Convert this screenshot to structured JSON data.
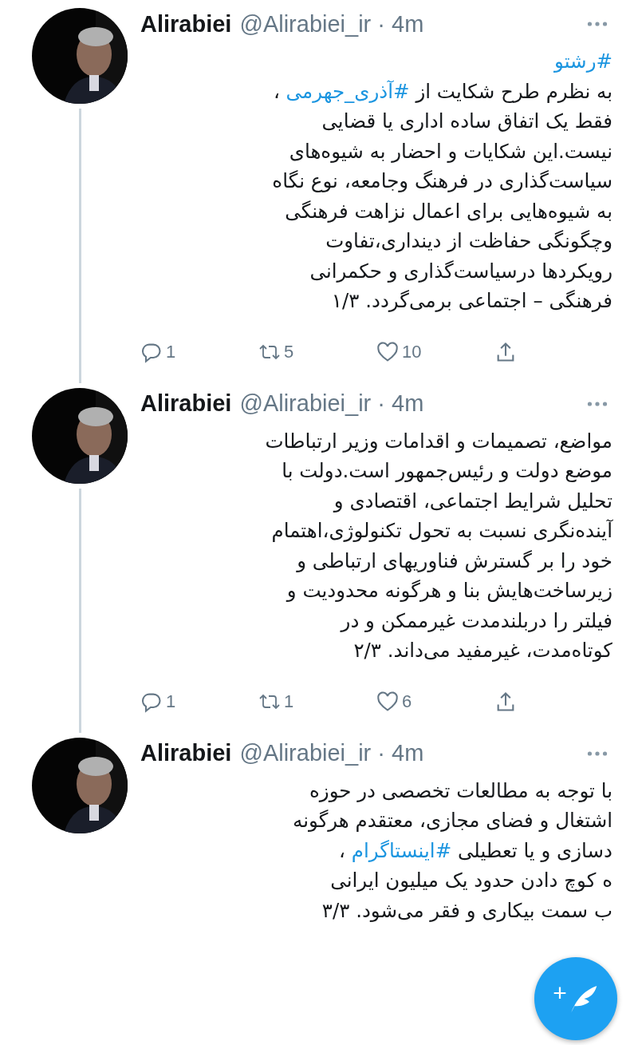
{
  "tweets": [
    {
      "name": "Alirabiei",
      "handle_time": "@Alirabiei_ir · 4m",
      "avatar": {
        "kind": "picture"
      },
      "lines": [
        [
          {
            "text": "#رشتو",
            "kind": "hashtag"
          }
        ],
        [
          {
            "text": "به نظرم طرح شکایت از ",
            "kind": "text"
          },
          {
            "text": "#آذری_جهرمی",
            "kind": "hashtag"
          },
          {
            "text": " ،",
            "kind": "text"
          }
        ],
        [
          {
            "text": "فقط یک اتفاق ساده اداری یا قضایی",
            "kind": "text"
          }
        ],
        [
          {
            "text": "نیست.این شکایات و احضار به شیوه‌های",
            "kind": "text"
          }
        ],
        [
          {
            "text": "سیاست‌گذاری در فرهنگ وجامعه، نوع نگاه",
            "kind": "text"
          }
        ],
        [
          {
            "text": "به شیوه‌هایی برای اعمال نزاهت فرهنگی",
            "kind": "text"
          }
        ],
        [
          {
            "text": "وچگونگی حفاظت از دینداری،تفاوت",
            "kind": "text"
          }
        ],
        [
          {
            "text": "رویکردها درسیاست‌گذاری و حکمرانی",
            "kind": "text"
          }
        ],
        [
          {
            "text": "فرهنگی – اجتماعی برمی‌گردد. ۱/۳",
            "kind": "text"
          }
        ]
      ],
      "actions": {
        "replies": "1",
        "retweets": "5",
        "likes": "10"
      }
    },
    {
      "name": "Alirabiei",
      "handle_time": "@Alirabiei_ir · 4m",
      "avatar": {
        "kind": "picture"
      },
      "lines": [
        [
          {
            "text": "مواضع، تصمیمات و اقدامات وزیر ارتباطات",
            "kind": "text"
          }
        ],
        [
          {
            "text": "موضع دولت و رئیس‌جمهور است.دولت با",
            "kind": "text"
          }
        ],
        [
          {
            "text": "تحلیل شرایط اجتماعی، اقتصادی و",
            "kind": "text"
          }
        ],
        [
          {
            "text": "آینده‌نگری نسبت به تحول تکنولوژی،اهتمام",
            "kind": "text"
          }
        ],
        [
          {
            "text": "خود را بر گسترش فناوریهای ارتباطی و",
            "kind": "text"
          }
        ],
        [
          {
            "text": "زیرساخت‌هایش بنا و هرگونه محدودیت و",
            "kind": "text"
          }
        ],
        [
          {
            "text": "فیلتر را دربلندمدت غیرممکن و در",
            "kind": "text"
          }
        ],
        [
          {
            "text": "کوتاه‌مدت، غیرمفید می‌داند. ۲/۳",
            "kind": "text"
          }
        ]
      ],
      "actions": {
        "replies": "1",
        "retweets": "1",
        "likes": "6"
      }
    },
    {
      "name": "Alirabiei",
      "handle_time": "@Alirabiei_ir · 4m",
      "avatar": {
        "kind": "picture"
      },
      "lines": [
        [
          {
            "text": "با توجه به مطالعات تخصصی در حوزه",
            "kind": "text"
          }
        ],
        [
          {
            "text": "اشتغال و فضای مجازی، معتقدم هرگونه",
            "kind": "text"
          }
        ],
        [
          {
            "text": "دسازی و یا تعطیلی ",
            "kind": "text"
          },
          {
            "text": "#اینستاگرام",
            "kind": "hashtag"
          },
          {
            "text": " ،",
            "kind": "text"
          }
        ],
        [
          {
            "text": "ه کوچ دادن حدود یک میلیون ایرانی",
            "kind": "text"
          }
        ],
        [
          {
            "text": "ب سمت بیکاری و فقر می‌شود. ۳/۳",
            "kind": "text"
          }
        ]
      ]
    }
  ],
  "compose_button": {
    "label": "+"
  }
}
